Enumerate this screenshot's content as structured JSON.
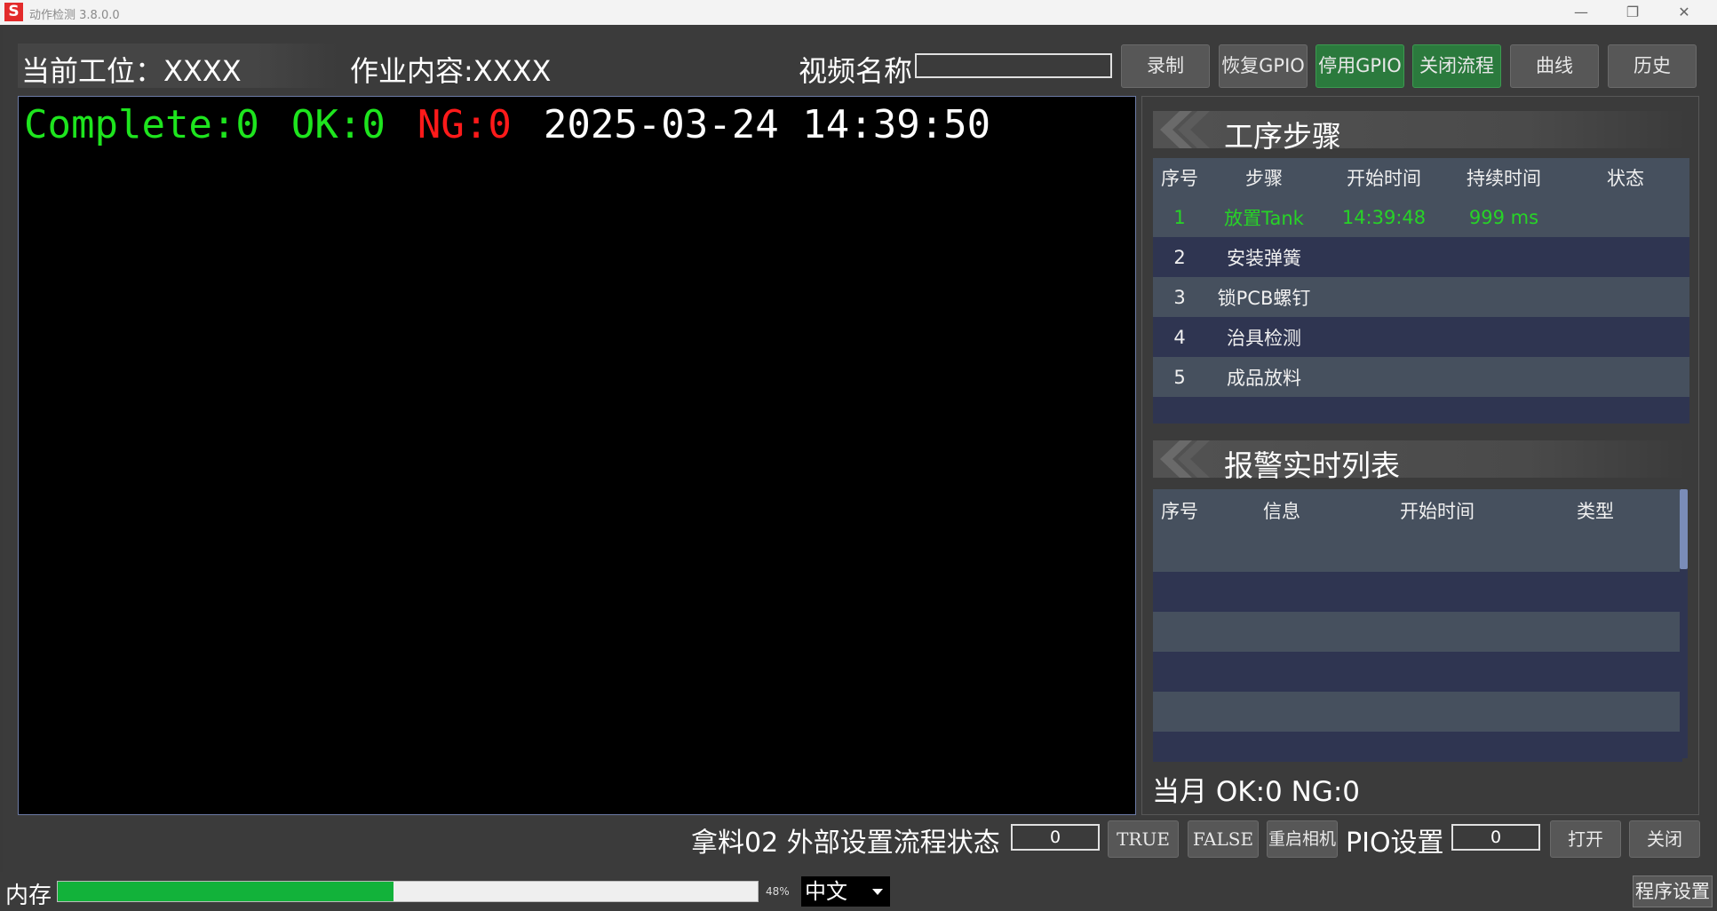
{
  "window": {
    "logo_letter": "S",
    "title": "动作检测 3.8.0.0",
    "minimize": "—",
    "restore": "❐",
    "close": "✕"
  },
  "header": {
    "station": "当前工位：XXXX",
    "job": "作业内容:XXXX",
    "video_label": "视频名称",
    "video_value": ""
  },
  "toolbar": {
    "record": "录制",
    "restore_gpio": "恢复GPIO",
    "disable_gpio": "停用GPIO",
    "close_flow": "关闭流程",
    "curve": "曲线",
    "history": "历史"
  },
  "stats": {
    "complete": "Complete:0",
    "ok": "OK:0",
    "ng": "NG:0",
    "datetime": "2025-03-24 14:39:50"
  },
  "steps": {
    "title": "工序步骤",
    "columns": [
      "序号",
      "步骤",
      "开始时间",
      "持续时间",
      "状态"
    ],
    "rows": [
      {
        "no": "1",
        "step": "放置Tank",
        "start": "14:39:48",
        "duration": "999 ms",
        "status": ""
      },
      {
        "no": "2",
        "step": "安装弹簧",
        "start": "",
        "duration": "",
        "status": ""
      },
      {
        "no": "3",
        "step": "锁PCB螺钉",
        "start": "",
        "duration": "",
        "status": ""
      },
      {
        "no": "4",
        "step": "治具检测",
        "start": "",
        "duration": "",
        "status": ""
      },
      {
        "no": "5",
        "step": "成品放料",
        "start": "",
        "duration": "",
        "status": ""
      }
    ]
  },
  "alarms": {
    "title": "报警实时列表",
    "columns": [
      "序号",
      "信息",
      "开始时间",
      "类型"
    ]
  },
  "month_summary": "当月 OK:0 NG:0",
  "bottom": {
    "pick_label": "拿料02 外部设置流程状态",
    "flow_state_value": "0",
    "true_btn": "TRUE",
    "false_btn": "FALSE",
    "restart_camera": "重启相机",
    "pio_label": "PIO设置",
    "pio_value": "0",
    "open_btn": "打开",
    "close_btn": "关闭"
  },
  "status": {
    "memory_label": "内存",
    "memory_percent": 48,
    "memory_text": "48%",
    "language": "中文",
    "program_settings": "程序设置"
  },
  "colors": {
    "ok_green": "#1ee51e",
    "ng_red": "#ff1a1a",
    "button_green": "#2b7a3d",
    "table_row_light": "#46505e",
    "table_row_dark": "#2f3551",
    "progress_green": "#12b23a"
  }
}
